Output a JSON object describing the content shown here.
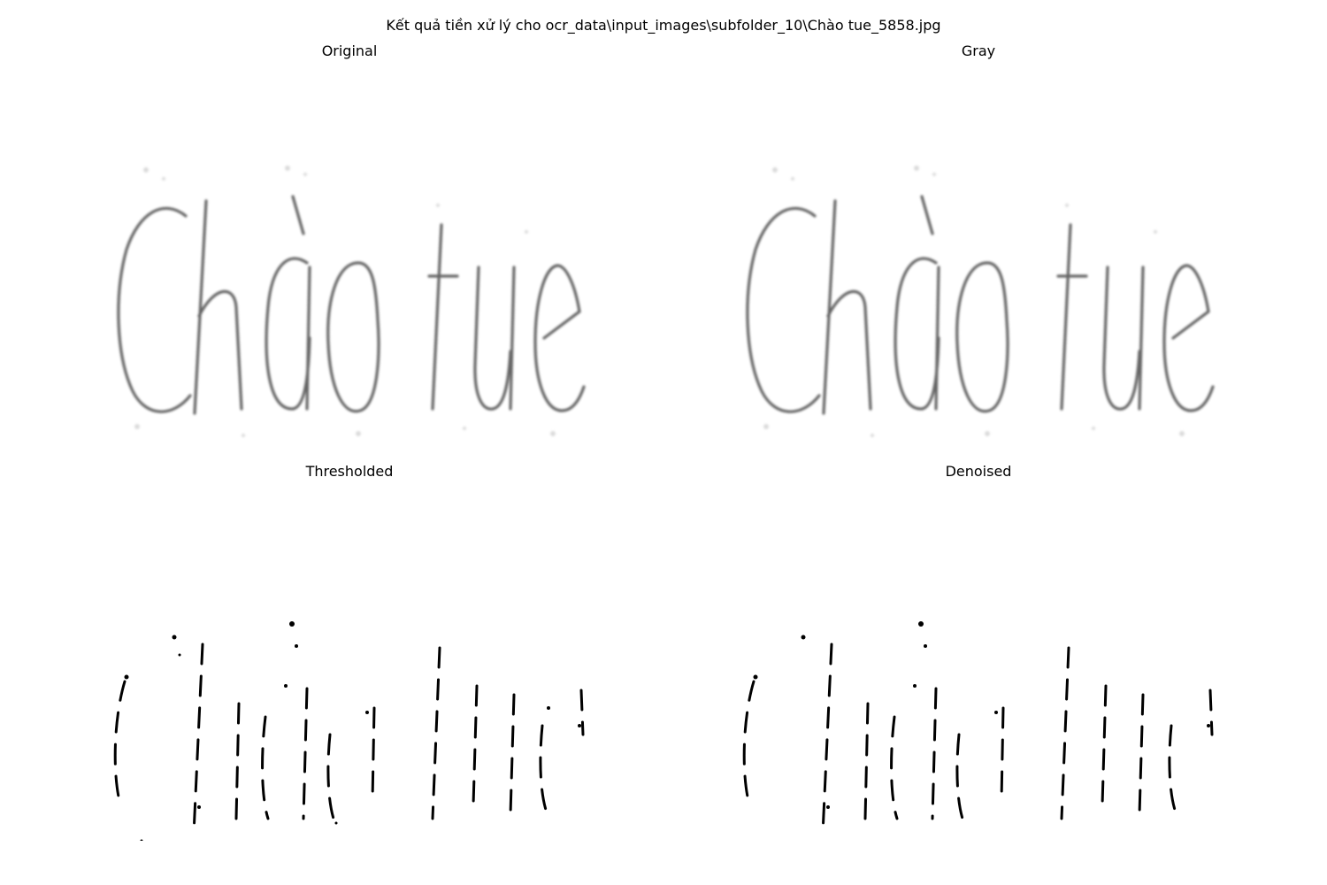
{
  "figure": {
    "title": "Kết quả tiền xử lý cho ocr_data\\input_images\\subfolder_10\\Chào tue_5858.jpg"
  },
  "panels": [
    {
      "title": "Original"
    },
    {
      "title": "Gray"
    },
    {
      "title": "Thresholded"
    },
    {
      "title": "Denoised"
    }
  ],
  "image_content": {
    "text": "Chào tue",
    "ink_color_soft": "#555555",
    "ink_color_binary": "#000000",
    "background_color": "#ffffff"
  }
}
